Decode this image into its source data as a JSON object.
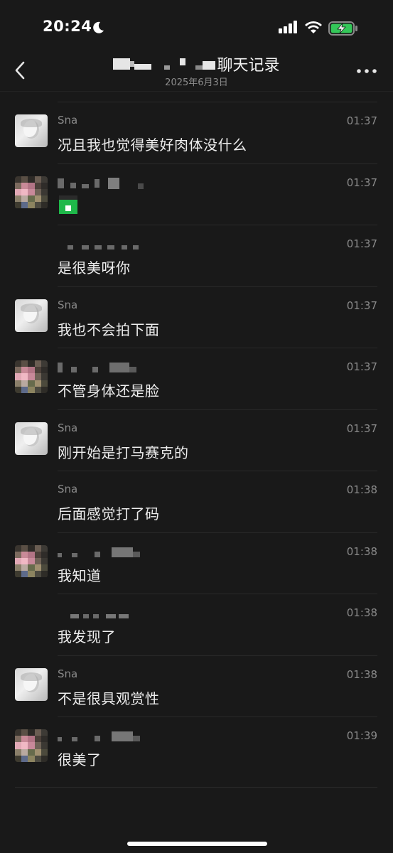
{
  "status_bar": {
    "time": "20:24"
  },
  "header": {
    "title_suffix": "聊天记录",
    "date": "2025年6月3日"
  },
  "messages": [
    {
      "sender": "Sna",
      "masked_sender": false,
      "avatar": "a",
      "time": "01:37",
      "text": "况且我也觉得美好肉体没什么"
    },
    {
      "sender": "",
      "masked_sender": true,
      "avatar": "b",
      "time": "01:37",
      "text": "",
      "sticker": true
    },
    {
      "sender": "",
      "masked_sender": true,
      "avatar": "none",
      "time": "01:37",
      "text": "是很美呀你"
    },
    {
      "sender": "Sna",
      "masked_sender": false,
      "avatar": "a",
      "time": "01:37",
      "text": "我也不会拍下面"
    },
    {
      "sender": "",
      "masked_sender": true,
      "avatar": "b",
      "time": "01:37",
      "text": "不管身体还是脸"
    },
    {
      "sender": "Sna",
      "masked_sender": false,
      "avatar": "a",
      "time": "01:37",
      "text": "刚开始是打马赛克的"
    },
    {
      "sender": "Sna",
      "masked_sender": false,
      "avatar": "none",
      "time": "01:38",
      "text": "后面感觉打了码"
    },
    {
      "sender": "",
      "masked_sender": true,
      "avatar": "b",
      "time": "01:38",
      "text": "我知道"
    },
    {
      "sender": "",
      "masked_sender": true,
      "avatar": "none",
      "time": "01:38",
      "text": "我发现了"
    },
    {
      "sender": "Sna",
      "masked_sender": false,
      "avatar": "a",
      "time": "01:38",
      "text": "不是很具观赏性"
    },
    {
      "sender": "",
      "masked_sender": true,
      "avatar": "b",
      "time": "01:39",
      "text": "很美了"
    }
  ],
  "colors": {
    "background": "#191919",
    "text": "#ededed",
    "secondary": "#8a8a8a",
    "battery_green": "#34c759",
    "sticker_green": "#1fb84a"
  },
  "icons": {
    "back": "chevron-left-icon",
    "more": "more-dots-icon",
    "signal": "cellular-signal-icon",
    "wifi": "wifi-icon",
    "battery": "battery-charging-icon",
    "moon": "moon-icon"
  }
}
